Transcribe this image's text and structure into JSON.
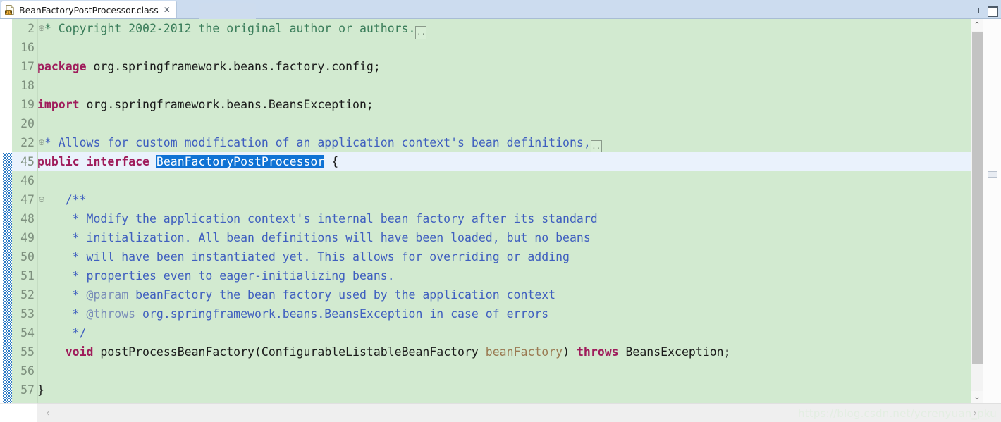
{
  "window": {
    "minimize_label": "Minimize",
    "maximize_label": "Maximize"
  },
  "tab": {
    "label": "BeanFactoryPostProcessor.class",
    "close_glyph": "✕",
    "icon_name": "class-file-icon"
  },
  "editor": {
    "current_line": 45,
    "selection_text": "BeanFactoryPostProcessor",
    "fold_placeholder": "..",
    "lines": [
      {
        "num": "2",
        "fold": "⊕",
        "current": false,
        "tokens": [
          {
            "t": "cm",
            "v": " * Copyright 2002-2012 the original author or authors."
          },
          {
            "t": "foldbox",
            "v": ".."
          }
        ]
      },
      {
        "num": "16",
        "fold": "",
        "current": false,
        "tokens": []
      },
      {
        "num": "17",
        "fold": "",
        "current": false,
        "tokens": [
          {
            "t": "k",
            "v": "package"
          },
          {
            "t": "pl",
            "v": " org.springframework.beans.factory.config;"
          }
        ]
      },
      {
        "num": "18",
        "fold": "",
        "current": false,
        "tokens": []
      },
      {
        "num": "19",
        "fold": "",
        "current": false,
        "tokens": [
          {
            "t": "k",
            "v": "import"
          },
          {
            "t": "pl",
            "v": " org.springframework.beans.BeansException;"
          }
        ]
      },
      {
        "num": "20",
        "fold": "",
        "current": false,
        "tokens": []
      },
      {
        "num": "22",
        "fold": "⊕",
        "current": false,
        "tokens": [
          {
            "t": "jd",
            "v": " * Allows for custom modification of an application context's bean definitions,"
          },
          {
            "t": "foldbox",
            "v": ".."
          }
        ]
      },
      {
        "num": "45",
        "fold": "",
        "current": true,
        "tokens": [
          {
            "t": "k",
            "v": "public interface "
          },
          {
            "t": "sel",
            "v": "BeanFactoryPostProcessor"
          },
          {
            "t": "pl",
            "v": " {"
          }
        ]
      },
      {
        "num": "46",
        "fold": "",
        "current": false,
        "tokens": []
      },
      {
        "num": "47",
        "fold": "⊖",
        "current": false,
        "tokens": [
          {
            "t": "jd",
            "v": "    /**"
          }
        ]
      },
      {
        "num": "48",
        "fold": "",
        "current": false,
        "tokens": [
          {
            "t": "jd",
            "v": "     * Modify the application context's internal bean factory after its standard"
          }
        ]
      },
      {
        "num": "49",
        "fold": "",
        "current": false,
        "tokens": [
          {
            "t": "jd",
            "v": "     * initialization. All bean definitions will have been loaded, but no beans"
          }
        ]
      },
      {
        "num": "50",
        "fold": "",
        "current": false,
        "tokens": [
          {
            "t": "jd",
            "v": "     * will have been instantiated yet. This allows for overriding or adding"
          }
        ]
      },
      {
        "num": "51",
        "fold": "",
        "current": false,
        "tokens": [
          {
            "t": "jd",
            "v": "     * properties even to eager-initializing beans."
          }
        ]
      },
      {
        "num": "52",
        "fold": "",
        "current": false,
        "tokens": [
          {
            "t": "jd",
            "v": "     * "
          },
          {
            "t": "jdt",
            "v": "@param"
          },
          {
            "t": "jd",
            "v": " beanFactory the bean factory used by the application context"
          }
        ]
      },
      {
        "num": "53",
        "fold": "",
        "current": false,
        "tokens": [
          {
            "t": "jd",
            "v": "     * "
          },
          {
            "t": "jdt",
            "v": "@throws"
          },
          {
            "t": "jd",
            "v": " org.springframework.beans.BeansException in case of errors"
          }
        ]
      },
      {
        "num": "54",
        "fold": "",
        "current": false,
        "tokens": [
          {
            "t": "jd",
            "v": "     */"
          }
        ]
      },
      {
        "num": "55",
        "fold": "",
        "current": false,
        "tokens": [
          {
            "t": "pl",
            "v": "    "
          },
          {
            "t": "k",
            "v": "void"
          },
          {
            "t": "pl",
            "v": " postProcessBeanFactory(ConfigurableListableBeanFactory "
          },
          {
            "t": "prm",
            "v": "beanFactory"
          },
          {
            "t": "pl",
            "v": ") "
          },
          {
            "t": "k",
            "v": "throws"
          },
          {
            "t": "pl",
            "v": " BeansException;"
          }
        ]
      },
      {
        "num": "56",
        "fold": "",
        "current": false,
        "tokens": []
      },
      {
        "num": "57",
        "fold": "",
        "current": false,
        "tokens": [
          {
            "t": "pl",
            "v": "}"
          }
        ]
      }
    ]
  },
  "scrollbars": {
    "up_arrow_glyph": "⌃",
    "down_arrow_glyph": "⌄",
    "left_arrow_glyph": "‹",
    "right_arrow_glyph": "›"
  },
  "watermark": {
    "text": "https://blog.csdn.net/yerenyuan_pku"
  },
  "colors": {
    "editor_background": "#d2ead0",
    "current_line": "#eaf2fc",
    "selection": "#0f72d4",
    "keyword": "#9f1c5b",
    "javadoc": "#3f5fbf",
    "javadoc_tag": "#7a8eb8",
    "comment": "#3a7d5a",
    "parameter": "#9a7a52",
    "change_bar": "#1c6fc0",
    "tabbar": "#ccdcef"
  }
}
